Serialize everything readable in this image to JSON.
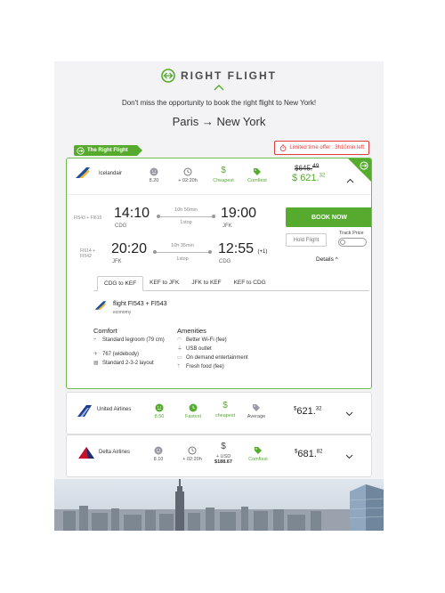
{
  "brand": {
    "name": "RIGHT FLIGHT",
    "color": "#56ab2f"
  },
  "banner": {
    "message": "Don't miss the opportunity to book the right flight to New York!",
    "route": "Paris → New York"
  },
  "tag": {
    "label": "The Right Flight"
  },
  "offer": {
    "label": "Limited time offer : 3h10min left",
    "icon": "stopwatch-icon"
  },
  "featured": {
    "airline": "Icelandair",
    "rating": "8.20",
    "duration_extra": "+ 02:20h",
    "cheapest_label": "Cheapest",
    "comfort_label": "Comfiest",
    "old_price": "645.",
    "old_price_cents": "49",
    "price": "621.",
    "price_cents": "32",
    "outbound": {
      "flight_no": "FI543 + FI615",
      "dep_time": "14:10",
      "dep_code": "CDG",
      "duration": "10h 50min",
      "stops": "1stop",
      "arr_time": "19:00",
      "arr_code": "JFK",
      "arr_suffix": ""
    },
    "inbound": {
      "flight_no": "FI614 + FI542",
      "dep_time": "20:20",
      "dep_code": "JFK",
      "duration": "10h 35min",
      "stops": "1stop",
      "arr_time": "12:55",
      "arr_code": "CDG",
      "arr_suffix": "(+1)"
    },
    "book_label": "BOOK NOW",
    "hold_label": "Hold Flight",
    "track_label": "Track Price",
    "details_label": "Details",
    "tabs": [
      "CDG to KEF",
      "KEF to JFK",
      "JFK to KEF",
      "KEF to CDG"
    ],
    "segment_title": "flight FI543 + FI543",
    "segment_class": "economy",
    "comfort_heading": "Comfort",
    "comfort_items": [
      "Standard legroom (79 cm)",
      "767 (widebody)",
      "Standard 2-3-2 layout"
    ],
    "amenities_heading": "Amenities",
    "amenity_items": [
      "Better Wi-Fi (fee)",
      "USB outlet",
      "On demand entertainment",
      "Fresh food (fee)"
    ]
  },
  "united": {
    "airline": "United Airlines",
    "rating": "8.50",
    "fastest_label": "Fastest",
    "cheapest_label": "cheapest",
    "average_label": "Average",
    "price": "621.",
    "price_cents": "32"
  },
  "delta": {
    "airline": "Delta Airlines",
    "rating": "8.10",
    "duration_extra": "+ 02:20h",
    "usd_label": "+ USD",
    "usd_value": "$188.67",
    "comfort_label": "Comfiest",
    "price": "681.",
    "price_cents": "82"
  }
}
